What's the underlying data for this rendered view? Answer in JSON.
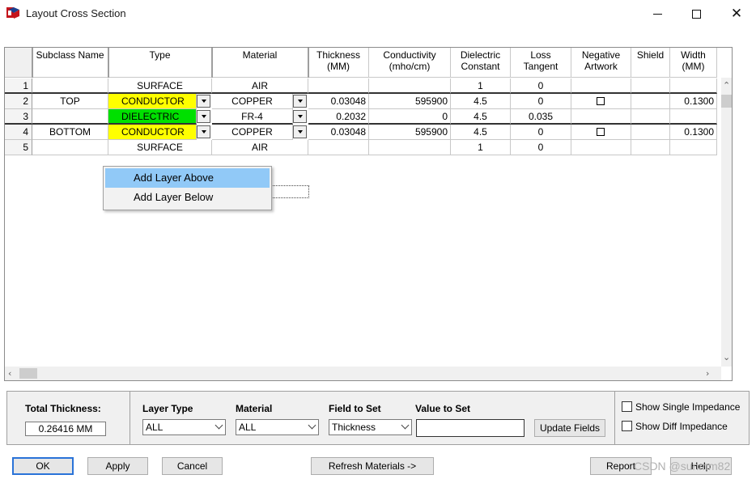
{
  "window": {
    "title": "Layout Cross Section",
    "close_glyph": "✕"
  },
  "grid": {
    "columns": [
      "",
      "Subclass Name",
      "Type",
      "Material",
      "Thickness\n(MM)",
      "Conductivity\n(mho/cm)",
      "Dielectric\nConstant",
      "Loss\nTangent",
      "Negative\nArtwork",
      "Shield",
      "Width\n(MM)"
    ],
    "rows": [
      {
        "num": "1",
        "subclass": "",
        "type": "SURFACE",
        "material": "AIR",
        "thickness": "",
        "conductivity": "",
        "dielectric": "1",
        "loss": "0",
        "negative": "",
        "shield": "",
        "width": ""
      },
      {
        "num": "2",
        "subclass": "TOP",
        "type": "CONDUCTOR",
        "material": "COPPER",
        "thickness": "0.03048",
        "conductivity": "595900",
        "dielectric": "4.5",
        "loss": "0",
        "negative": "checkbox",
        "shield": "",
        "width": "0.1300"
      },
      {
        "num": "3",
        "subclass": "",
        "type": "DIELECTRIC",
        "material": "FR-4",
        "thickness": "0.2032",
        "conductivity": "0",
        "dielectric": "4.5",
        "loss": "0.035",
        "negative": "",
        "shield": "",
        "width": ""
      },
      {
        "num": "4",
        "subclass": "BOTTOM",
        "type": "CONDUCTOR",
        "material": "COPPER",
        "thickness": "0.03048",
        "conductivity": "595900",
        "dielectric": "4.5",
        "loss": "0",
        "negative": "checkbox",
        "shield": "",
        "width": "0.1300"
      },
      {
        "num": "5",
        "subclass": "",
        "type": "SURFACE",
        "material": "AIR",
        "thickness": "",
        "conductivity": "",
        "dielectric": "1",
        "loss": "0",
        "negative": "",
        "shield": "",
        "width": ""
      }
    ],
    "type_colors": {
      "conductor": "#ffff00",
      "dielectric": "#00e000"
    }
  },
  "context_menu": {
    "items": [
      "Add Layer Above",
      "Add Layer Below"
    ],
    "highlight_color": "#91c9f7"
  },
  "panel": {
    "total_thickness_label": "Total Thickness:",
    "total_thickness_value": "0.26416 MM",
    "layer_type_label": "Layer Type",
    "layer_type_value": "ALL",
    "material_label": "Material",
    "material_value": "ALL",
    "field_label": "Field to Set",
    "field_value": "Thickness",
    "value_label": "Value to Set",
    "value_value": "",
    "update_button": "Update Fields",
    "show_single": "Show Single Impedance",
    "show_diff": "Show Diff Impedance"
  },
  "buttons": {
    "ok": "OK",
    "apply": "Apply",
    "cancel": "Cancel",
    "refresh": "Refresh Materials ->",
    "report": "Report",
    "help": "Help"
  },
  "watermark": "CSDN @sunmm82"
}
